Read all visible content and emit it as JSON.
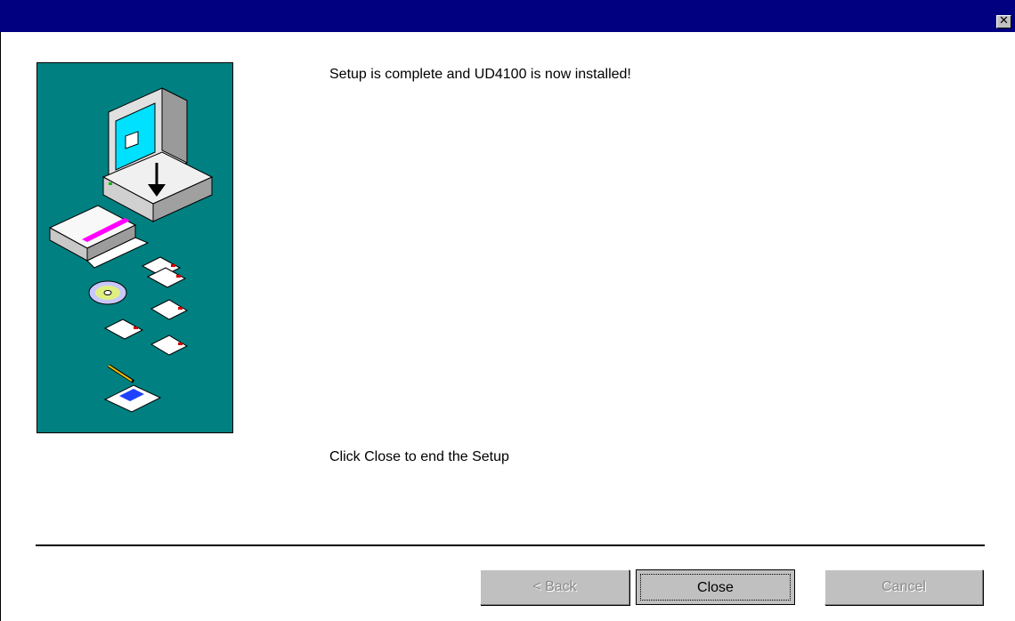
{
  "window": {
    "title": "",
    "close_glyph": "✕"
  },
  "content": {
    "message": "Setup is complete and UD4100 is now installed!",
    "instruction": "Click Close to end the Setup"
  },
  "buttons": {
    "back_label": "< Back",
    "close_label": "Close",
    "cancel_label": "Cancel"
  },
  "colors": {
    "titlebar": "#000080",
    "art_background": "#008080",
    "button_face": "#c0c0c0"
  },
  "icons": [
    "computer-icon",
    "download-arrow-icon",
    "software-box-icon",
    "cd-icon",
    "floppy-disk-icon",
    "pencil-icon",
    "notepad-icon"
  ]
}
